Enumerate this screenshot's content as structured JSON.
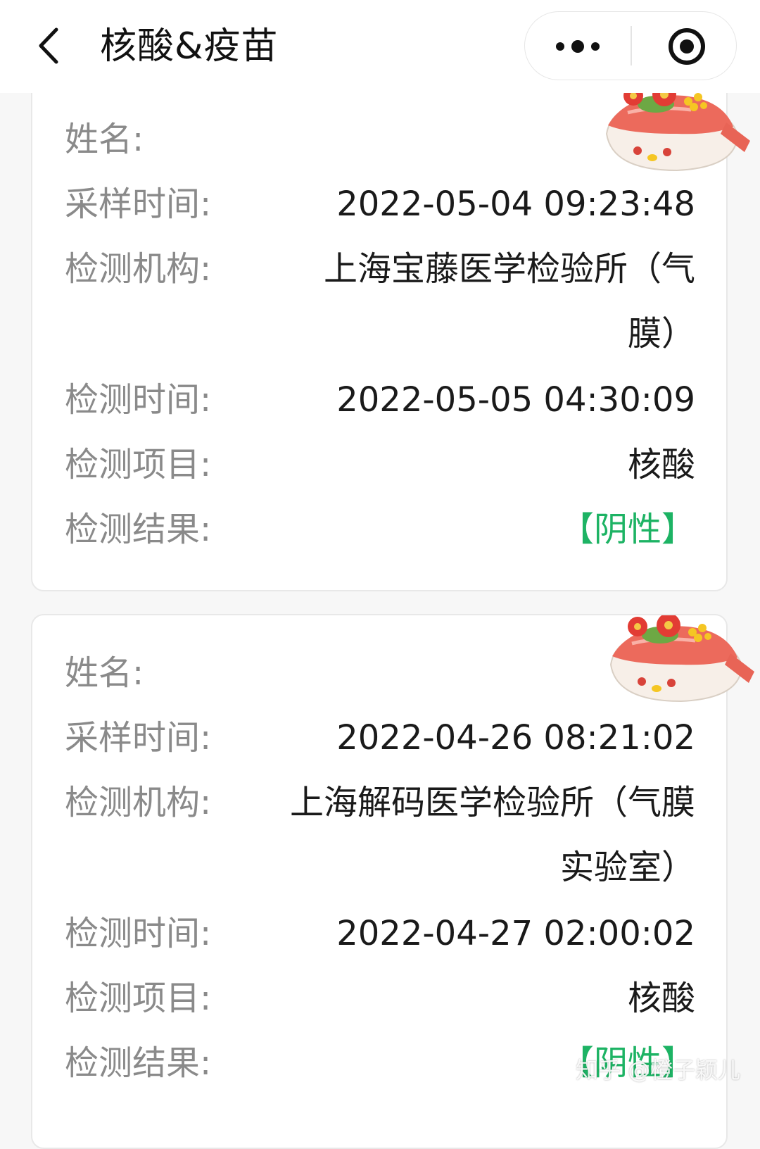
{
  "header": {
    "title": "核酸&疫苗"
  },
  "icons": {
    "back": "chevron-left-icon",
    "more": "more-dots-icon",
    "close": "target-circle-icon",
    "sticker": "sushi-sticker"
  },
  "colors": {
    "positive_green": "#1db364",
    "label_gray": "#8a8a8a"
  },
  "records": [
    {
      "name_label": "姓名:",
      "name_value": "",
      "sample_time_label": "采样时间:",
      "sample_time": "2022-05-04 09:23:48",
      "institution_label": "检测机构:",
      "institution": "上海宝藤医学检验所（气膜）",
      "test_time_label": "检测时间:",
      "test_time": "2022-05-05 04:30:09",
      "test_item_label": "检测项目:",
      "test_item": "核酸",
      "result_label": "检测结果:",
      "result": "【阴性】"
    },
    {
      "name_label": "姓名:",
      "name_value": "",
      "sample_time_label": "采样时间:",
      "sample_time": "2022-04-26 08:21:02",
      "institution_label": "检测机构:",
      "institution": "上海解码医学检验所（气膜实验室）",
      "test_time_label": "检测时间:",
      "test_time": "2022-04-27 02:00:02",
      "test_item_label": "检测项目:",
      "test_item": "核酸",
      "result_label": "检测结果:",
      "result": "【阴性】"
    }
  ],
  "watermark": "知乎 @橙子颖儿"
}
